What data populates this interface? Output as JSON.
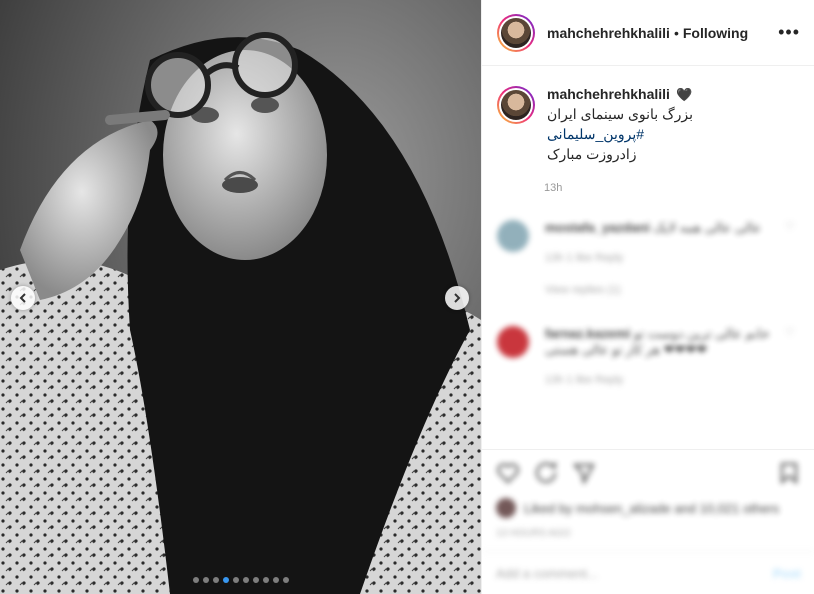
{
  "post": {
    "username": "mahchehrehkhalili",
    "separator": "•",
    "follow_status": "Following",
    "more_label": "•••"
  },
  "caption": {
    "username": "mahchehrehkhalili",
    "heart": "🖤",
    "lines": [
      "بزرگ بانوی سینمای ایران",
      "#پروین_سلیمانی",
      "زادروزت مبارک"
    ],
    "time": "13h"
  },
  "carousel": {
    "total": 10,
    "active": 3
  },
  "comments": [
    {
      "username": "mostafa_yazdani",
      "text": "عالی عالی همه لایک",
      "meta": "13h   1 like   Reply",
      "avatar_color": "#7fa3b0",
      "replies": "View replies (1)"
    },
    {
      "username": "farnaz.kazemi",
      "text": "خانم عالی ترین دوست تو هر کار تو عالی هستی ❤❤❤❤",
      "meta": "13h   1 like   Reply",
      "avatar_color": "#c0141c"
    }
  ],
  "footer": {
    "likes_text": "Liked by mohsen_alizade and 10,021 others",
    "date": "13 hours ago",
    "comment_placeholder": "Add a comment...",
    "post_label": "Post"
  },
  "colors": {
    "accent": "#3897f0",
    "border": "#efefef",
    "muted": "#999999"
  }
}
